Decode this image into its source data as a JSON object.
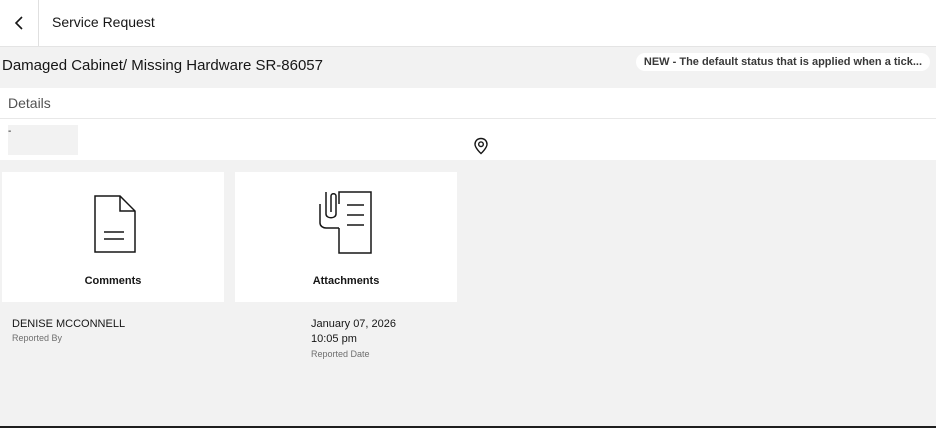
{
  "header": {
    "title": "Service Request"
  },
  "request": {
    "title": "Damaged Cabinet/ Missing Hardware SR-86057",
    "status": "NEW - The default status that is applied when a tick..."
  },
  "details": {
    "heading": "Details",
    "value": "-"
  },
  "tiles": [
    {
      "label": "Comments",
      "icon": "document-icon"
    },
    {
      "label": "Attachments",
      "icon": "attachment-icon"
    }
  ],
  "reported_by": {
    "value": "DENISE MCCONNELL",
    "label": "Reported By"
  },
  "reported_date": {
    "date": "January 07, 2026",
    "time": "10:05 pm",
    "label": "Reported Date"
  }
}
